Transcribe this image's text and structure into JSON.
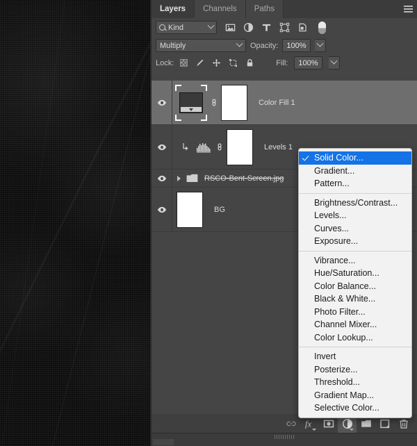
{
  "panel": {
    "tabs": [
      {
        "label": "Layers",
        "active": true
      },
      {
        "label": "Channels",
        "active": false
      },
      {
        "label": "Paths",
        "active": false
      }
    ],
    "menu_icon": "hamburger-menu-icon"
  },
  "filter": {
    "kind_label": "Kind",
    "search_icon": "search-icon",
    "icons": [
      {
        "name": "filter-pixel-layers-icon"
      },
      {
        "name": "filter-adjustment-layers-icon"
      },
      {
        "name": "filter-type-layers-icon"
      },
      {
        "name": "filter-shape-layers-icon"
      },
      {
        "name": "filter-smart-object-icon"
      }
    ],
    "toggle_name": "filter-enable-toggle"
  },
  "blend": {
    "mode": "Multiply",
    "opacity_label": "Opacity:",
    "opacity_value": "100%"
  },
  "lock": {
    "label": "Lock:",
    "icons": [
      {
        "name": "lock-transparent-pixels-icon"
      },
      {
        "name": "lock-image-pixels-icon"
      },
      {
        "name": "lock-position-icon"
      },
      {
        "name": "lock-artboard-nesting-icon"
      },
      {
        "name": "lock-all-icon"
      }
    ],
    "fill_label": "Fill:",
    "fill_value": "100%"
  },
  "layers": [
    {
      "name": "Color Fill 1",
      "type": "fill",
      "visible": true,
      "selected": true,
      "has_link": true,
      "has_mask": true,
      "thumb": "monitor-photo-thumbnail"
    },
    {
      "name": "Levels 1",
      "type": "adjustment",
      "visible": true,
      "selected": false,
      "clipped": true,
      "has_link": true,
      "has_mask": true,
      "thumb": "levels-histogram-icon"
    },
    {
      "name": "RSCO-Bent-Screen.jpg",
      "type": "group",
      "visible": true,
      "selected": false,
      "struck": true,
      "thumb": "folder-icon"
    },
    {
      "name": "BG",
      "type": "raster",
      "visible": true,
      "selected": false,
      "thumb": "white-thumbnail"
    }
  ],
  "bottom_toolbar": [
    {
      "name": "link-layers-button",
      "icon": "link-icon",
      "active": false,
      "has_menu": false
    },
    {
      "name": "layer-style-button",
      "icon": "fx-icon",
      "active": false,
      "has_menu": true
    },
    {
      "name": "add-layer-mask-button",
      "icon": "mask-icon",
      "active": false,
      "has_menu": false
    },
    {
      "name": "new-adjustment-layer-button",
      "icon": "half-circle-icon",
      "active": true,
      "has_menu": true
    },
    {
      "name": "new-group-button",
      "icon": "folder-icon",
      "active": false,
      "has_menu": false
    },
    {
      "name": "new-layer-button",
      "icon": "new-layer-icon",
      "active": false,
      "has_menu": false
    },
    {
      "name": "delete-layer-button",
      "icon": "trash-icon",
      "active": false,
      "has_menu": false
    }
  ],
  "context_menu": {
    "groups": [
      [
        {
          "label": "Solid Color...",
          "selected": true,
          "checked": true
        },
        {
          "label": "Gradient...",
          "selected": false,
          "checked": false
        },
        {
          "label": "Pattern...",
          "selected": false,
          "checked": false
        }
      ],
      [
        {
          "label": "Brightness/Contrast...",
          "selected": false,
          "checked": false
        },
        {
          "label": "Levels...",
          "selected": false,
          "checked": false
        },
        {
          "label": "Curves...",
          "selected": false,
          "checked": false
        },
        {
          "label": "Exposure...",
          "selected": false,
          "checked": false
        }
      ],
      [
        {
          "label": "Vibrance...",
          "selected": false,
          "checked": false
        },
        {
          "label": "Hue/Saturation...",
          "selected": false,
          "checked": false
        },
        {
          "label": "Color Balance...",
          "selected": false,
          "checked": false
        },
        {
          "label": "Black & White...",
          "selected": false,
          "checked": false
        },
        {
          "label": "Photo Filter...",
          "selected": false,
          "checked": false
        },
        {
          "label": "Channel Mixer...",
          "selected": false,
          "checked": false
        },
        {
          "label": "Color Lookup...",
          "selected": false,
          "checked": false
        }
      ],
      [
        {
          "label": "Invert",
          "selected": false,
          "checked": false
        },
        {
          "label": "Posterize...",
          "selected": false,
          "checked": false
        },
        {
          "label": "Threshold...",
          "selected": false,
          "checked": false
        },
        {
          "label": "Gradient Map...",
          "selected": false,
          "checked": false
        },
        {
          "label": "Selective Color...",
          "selected": false,
          "checked": false
        }
      ]
    ]
  },
  "colors": {
    "panel_bg": "#454545",
    "tab_bg": "#3b3b3b",
    "selected_layer": "#6e6e6e",
    "menu_highlight": "#1473e6",
    "menu_bg": "#f2f2f2",
    "text": "#d4d4d4",
    "canvas": "#0d0d0d"
  }
}
